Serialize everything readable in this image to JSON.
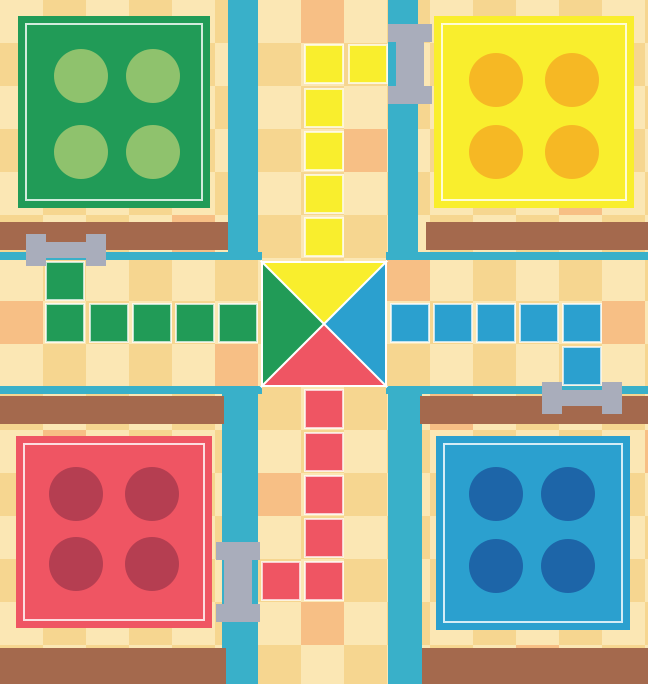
{
  "colors": {
    "board_light": "#fbe7b4",
    "board_mid": "#f5d28a",
    "board_orange": "#f6b77c",
    "wood": "#a4694d",
    "channel": "#39b0c9",
    "clamp": "#a9adbb",
    "green": "#219b57",
    "green_piece": "#8fc26d",
    "yellow": "#f9ee2d",
    "yellow_piece": "#f6b824",
    "red": "#ef5563",
    "red_piece": "#b53e51",
    "blue": "#2ba0cf",
    "blue_piece": "#1d65a8"
  },
  "players": [
    {
      "color": "green",
      "corner": "top-left",
      "pieces_at_home": 4
    },
    {
      "color": "yellow",
      "corner": "top-right",
      "pieces_at_home": 4
    },
    {
      "color": "red",
      "corner": "bottom-left",
      "pieces_at_home": 4
    },
    {
      "color": "blue",
      "corner": "bottom-right",
      "pieces_at_home": 4
    }
  ],
  "center": {
    "triangles": [
      "yellow",
      "green",
      "blue",
      "red"
    ]
  },
  "clamps": [
    "yellow-start-clamp",
    "green-start-clamp",
    "blue-start-clamp",
    "red-start-clamp"
  ]
}
